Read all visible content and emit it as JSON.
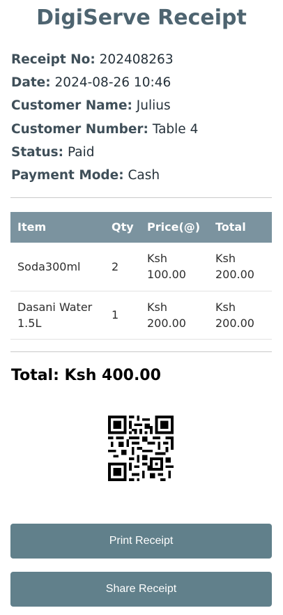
{
  "title": "DigiServe Receipt",
  "info": [
    {
      "label": "Receipt No:",
      "value": "202408263"
    },
    {
      "label": "Date:",
      "value": "2024-08-26 10:46"
    },
    {
      "label": "Customer Name:",
      "value": "Julius"
    },
    {
      "label": "Customer Number:",
      "value": "Table 4"
    },
    {
      "label": "Status:",
      "value": "Paid"
    },
    {
      "label": "Payment Mode:",
      "value": "Cash"
    }
  ],
  "table": {
    "headers": [
      "Item",
      "Qty",
      "Price(@)",
      "Total"
    ],
    "rows": [
      {
        "item": "Soda300ml",
        "qty": "2",
        "price": "Ksh 100.00",
        "total": "Ksh 200.00"
      },
      {
        "item": "Dasani Water 1.5L",
        "qty": "1",
        "price": "Ksh 200.00",
        "total": "Ksh 200.00"
      }
    ]
  },
  "total_text": "Total: Ksh 400.00",
  "qr_icon": "qr-code-icon",
  "buttons": {
    "print": "Print Receipt",
    "share": "Share Receipt"
  },
  "colors": {
    "title": "#4e6470",
    "table_header": "#7b939f",
    "button": "#61808b"
  }
}
